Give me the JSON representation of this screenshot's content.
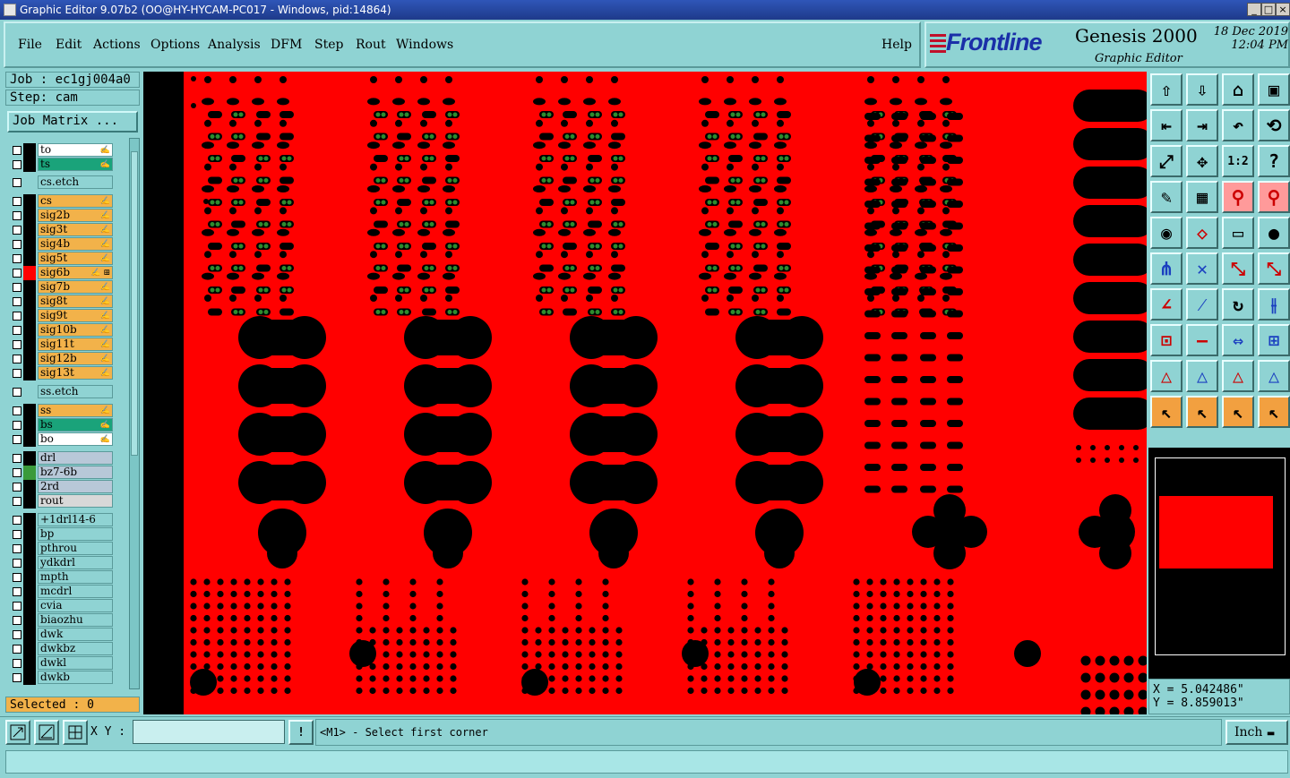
{
  "window": {
    "title": "Graphic Editor 9.07b2 (OO@HY-HYCAM-PC017 - Windows, pid:14864)",
    "min": "_",
    "max": "□",
    "close": "×"
  },
  "menu": {
    "file": "File",
    "edit": "Edit",
    "actions": "Actions",
    "options": "Options",
    "analysis": "Analysis",
    "dfm": "DFM",
    "step": "Step",
    "rout": "Rout",
    "windows": "Windows",
    "help": "Help"
  },
  "brand": {
    "logo": "Frontline",
    "product": "Genesis 2000",
    "subtitle": "Graphic Editor",
    "date": "18 Dec 2019",
    "time": "12:04 PM"
  },
  "job": {
    "job_label": "Job : ec1gj004a0",
    "step_label": "Step: cam",
    "matrix_button": "Job Matrix ..."
  },
  "layers": [
    {
      "name": "to",
      "color": "#ffffff",
      "edit": "✍",
      "swatch": "#000000"
    },
    {
      "name": "ts",
      "color": "#1aa37a",
      "edit": "✍",
      "swatch": "#000000"
    },
    {
      "name": "cs.etch",
      "color": "#8fd3d3",
      "edit": "",
      "swatch": ""
    },
    {
      "name": "cs",
      "color": "#f2b24a",
      "edit": "✍",
      "swatch": "#000000"
    },
    {
      "name": "sig2b",
      "color": "#f2b24a",
      "edit": "✍",
      "swatch": "#000000"
    },
    {
      "name": "sig3t",
      "color": "#f2b24a",
      "edit": "✍",
      "swatch": "#000000"
    },
    {
      "name": "sig4b",
      "color": "#f2b24a",
      "edit": "✍",
      "swatch": "#000000"
    },
    {
      "name": "sig5t",
      "color": "#f2b24a",
      "edit": "✍",
      "swatch": "#000000"
    },
    {
      "name": "sig6b",
      "color": "#f2b24a",
      "edit": "✍ ⊞",
      "swatch": "#ff0000"
    },
    {
      "name": "sig7b",
      "color": "#f2b24a",
      "edit": "✍",
      "swatch": "#000000"
    },
    {
      "name": "sig8t",
      "color": "#f2b24a",
      "edit": "✍",
      "swatch": "#000000"
    },
    {
      "name": "sig9t",
      "color": "#f2b24a",
      "edit": "✍",
      "swatch": "#000000"
    },
    {
      "name": "sig10b",
      "color": "#f2b24a",
      "edit": "✍",
      "swatch": "#000000"
    },
    {
      "name": "sig11t",
      "color": "#f2b24a",
      "edit": "✍",
      "swatch": "#000000"
    },
    {
      "name": "sig12b",
      "color": "#f2b24a",
      "edit": "✍",
      "swatch": "#000000"
    },
    {
      "name": "sig13t",
      "color": "#f2b24a",
      "edit": "✍",
      "swatch": "#000000"
    },
    {
      "name": "ss.etch",
      "color": "#8fd3d3",
      "edit": "",
      "swatch": ""
    },
    {
      "name": "ss",
      "color": "#f2b24a",
      "edit": "✍",
      "swatch": "#000000"
    },
    {
      "name": "bs",
      "color": "#1aa37a",
      "edit": "✍",
      "swatch": "#000000"
    },
    {
      "name": "bo",
      "color": "#ffffff",
      "edit": "✍",
      "swatch": "#000000"
    },
    {
      "name": "drl",
      "color": "#b8c8d8",
      "edit": "",
      "swatch": "#000000"
    },
    {
      "name": "bz7-6b",
      "color": "#b8c8d8",
      "edit": "",
      "swatch": "#3a9a3a"
    },
    {
      "name": "2rd",
      "color": "#b8c8d8",
      "edit": "",
      "swatch": "#000000"
    },
    {
      "name": "rout",
      "color": "#d8d8d8",
      "edit": "",
      "swatch": "#000000"
    },
    {
      "name": "+1drl14-6",
      "color": "#8fd3d3",
      "edit": "",
      "swatch": "#000000"
    },
    {
      "name": "bp",
      "color": "#8fd3d3",
      "edit": "",
      "swatch": "#000000"
    },
    {
      "name": "pthrou",
      "color": "#8fd3d3",
      "edit": "",
      "swatch": "#000000"
    },
    {
      "name": "ydkdrl",
      "color": "#8fd3d3",
      "edit": "",
      "swatch": "#000000"
    },
    {
      "name": "mpth",
      "color": "#8fd3d3",
      "edit": "",
      "swatch": "#000000"
    },
    {
      "name": "mcdrl",
      "color": "#8fd3d3",
      "edit": "",
      "swatch": "#000000"
    },
    {
      "name": "cvia",
      "color": "#8fd3d3",
      "edit": "",
      "swatch": "#000000"
    },
    {
      "name": "biaozhu",
      "color": "#8fd3d3",
      "edit": "",
      "swatch": "#000000"
    },
    {
      "name": "dwk",
      "color": "#8fd3d3",
      "edit": "",
      "swatch": "#000000"
    },
    {
      "name": "dwkbz",
      "color": "#8fd3d3",
      "edit": "",
      "swatch": "#000000"
    },
    {
      "name": "dwkl",
      "color": "#8fd3d3",
      "edit": "",
      "swatch": "#000000"
    },
    {
      "name": "dwkb",
      "color": "#8fd3d3",
      "edit": "",
      "swatch": "#000000"
    }
  ],
  "selected": "Selected : 0",
  "coords": {
    "x": "X = 5.042486\"",
    "y": "Y = 8.859013\""
  },
  "bottom": {
    "xy_label": "X Y :",
    "xy_value": "",
    "prompt": "<M1> - Select first corner",
    "unit": "Inch",
    "excl": "!"
  },
  "colors": {
    "layer_red": "#ff0000",
    "pad_green": "#2e8b2e",
    "panel": "#8fd3d3"
  },
  "tools": [
    "zoom-home-icon",
    "zoom-in-icon",
    "house-icon",
    "window-icon",
    "pan-left-icon",
    "pan-right-icon",
    "undo-zoom-icon",
    "redraw-icon",
    "fit-icon",
    "center-icon",
    "scale-1-2-icon",
    "help-icon",
    "measure-icon",
    "grid-icon",
    "snap-red-icon",
    "snap-blue-icon",
    "pad-icon",
    "shape-icon",
    "ruler-icon",
    "circle-icon",
    "net-icon",
    "cross-icon",
    "connect-icon",
    "connect-arrow-icon",
    "line-red-icon",
    "line-blue-icon",
    "arc-icon",
    "split-icon",
    "select-pad-icon",
    "minus-icon",
    "dimension-icon",
    "group-icon",
    "triangle-red-icon",
    "triangle-blue-icon",
    "triangle-stack-icon",
    "triangle-flip-icon",
    "pointer-icon",
    "pointer-box-icon",
    "pointer-circle-icon",
    "pointer-net-icon"
  ]
}
